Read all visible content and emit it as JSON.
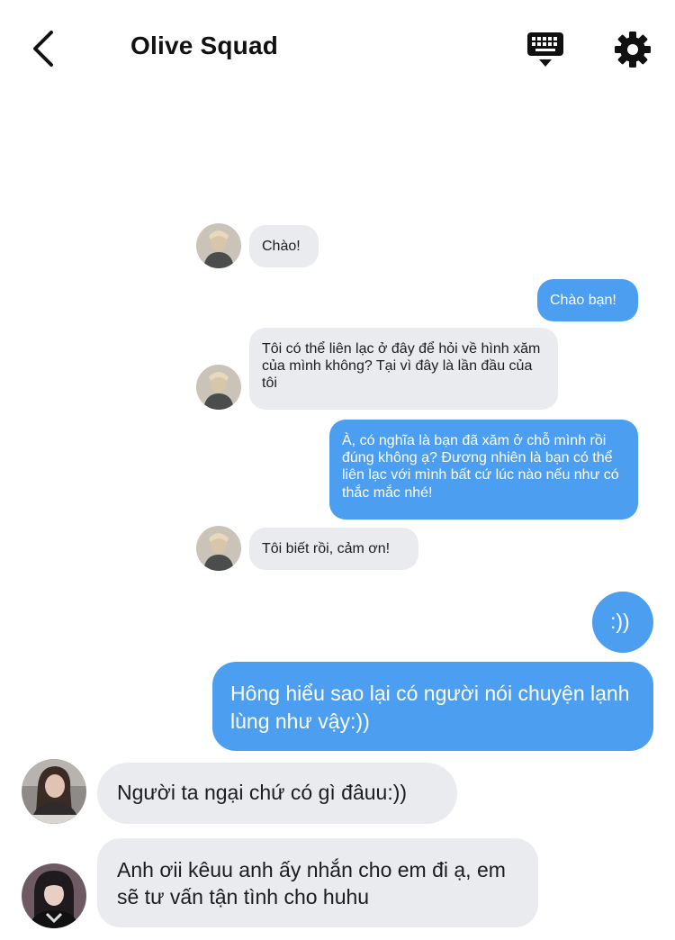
{
  "header": {
    "title": "Olive Squad",
    "back_icon": "chevron-left-icon",
    "keyboard_icon": "keyboard-icon",
    "settings_icon": "gear-icon"
  },
  "colors": {
    "outgoing_bubble": "#4c9ff0",
    "incoming_bubble": "#e9ebee",
    "text_dark": "#1c1c1e"
  },
  "messages": [
    {
      "direction": "incoming",
      "text": "Chào!"
    },
    {
      "direction": "outgoing",
      "text": "Chào bạn!"
    },
    {
      "direction": "incoming",
      "text": "Tôi có thể liên lạc ở đây để hỏi về hình xăm của mình không? Tại vì đây là lần đầu của tôi"
    },
    {
      "direction": "outgoing",
      "text": "À, có nghĩa là bạn đã xăm ở chỗ mình rồi đúng không ạ? Đương nhiên là bạn có thể liên lạc với mình bất cứ lúc nào nếu như có thắc mắc nhé!"
    },
    {
      "direction": "incoming",
      "text": "Tôi biết rồi, cảm ơn!"
    },
    {
      "direction": "outgoing",
      "text": ":))"
    },
    {
      "direction": "outgoing",
      "text": "Hông hiểu sao lại có người nói chuyện lạnh lùng như vậy:))"
    },
    {
      "direction": "incoming",
      "text": "Người ta ngại chứ có gì đâuu:))"
    },
    {
      "direction": "incoming",
      "text": "Anh ơii kêuu anh ấy nhắn cho em đi ạ, em sẽ tư vấn tận tình cho huhu"
    }
  ]
}
